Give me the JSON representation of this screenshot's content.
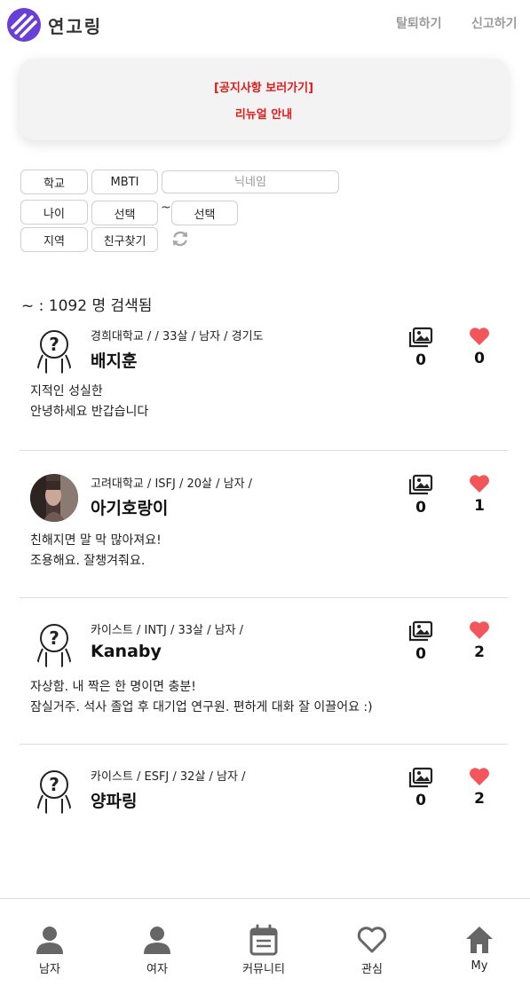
{
  "header": {
    "app_name": "연고링",
    "withdraw_label": "탈퇴하기",
    "report_label": "신고하기",
    "brand_color": "#6a3fd8"
  },
  "notice": {
    "line1": "[공지사항 보러가기]",
    "line2": "리뉴얼 안내",
    "color": "#e31a1a"
  },
  "filters": {
    "school": "학교",
    "mbti": "MBTI",
    "nickname_placeholder": "닉네임",
    "age": "나이",
    "age_from": "선택",
    "age_to": "선택",
    "tilde": "~",
    "region": "지역",
    "find_friends": "친구찾기",
    "refresh_icon": "refresh-icon"
  },
  "result_count": "~ : 1092 명 검색됨",
  "users": [
    {
      "meta": "경희대학교 / / 33살 / 남자 / 경기도",
      "name": "배지훈",
      "photos": "0",
      "likes": "0",
      "bio1": "지적인 성실한",
      "bio2": "안녕하세요 반갑습니다",
      "avatar": "default"
    },
    {
      "meta": "고려대학교 / ISFJ / 20살 / 남자 /",
      "name": "아기호랑이",
      "photos": "0",
      "likes": "1",
      "bio1": "친해지면 말 막 많아져요!",
      "bio2": "조용해요. 잘챙겨줘요.",
      "avatar": "photo"
    },
    {
      "meta": "카이스트 / INTJ / 33살 / 남자 /",
      "name": "Kanaby",
      "photos": "0",
      "likes": "2",
      "bio1": "자상함. 내 짝은 한 명이면 충분!",
      "bio2": "잠실거주. 석사 졸업 후 대기업 연구원. 편하게 대화 잘 이끌어요 :)",
      "avatar": "default"
    },
    {
      "meta": "카이스트 / ESFJ / 32살 / 남자 /",
      "name": "양파링",
      "photos": "0",
      "likes": "2",
      "bio1": "",
      "bio2": "",
      "avatar": "default"
    }
  ],
  "heart_color": "#f2555a",
  "bottom_nav": [
    {
      "label": "남자",
      "icon": "person-icon"
    },
    {
      "label": "여자",
      "icon": "person-icon"
    },
    {
      "label": "커뮤니티",
      "icon": "calendar-icon"
    },
    {
      "label": "관심",
      "icon": "heart-outline-icon"
    },
    {
      "label": "My",
      "icon": "home-icon"
    }
  ]
}
